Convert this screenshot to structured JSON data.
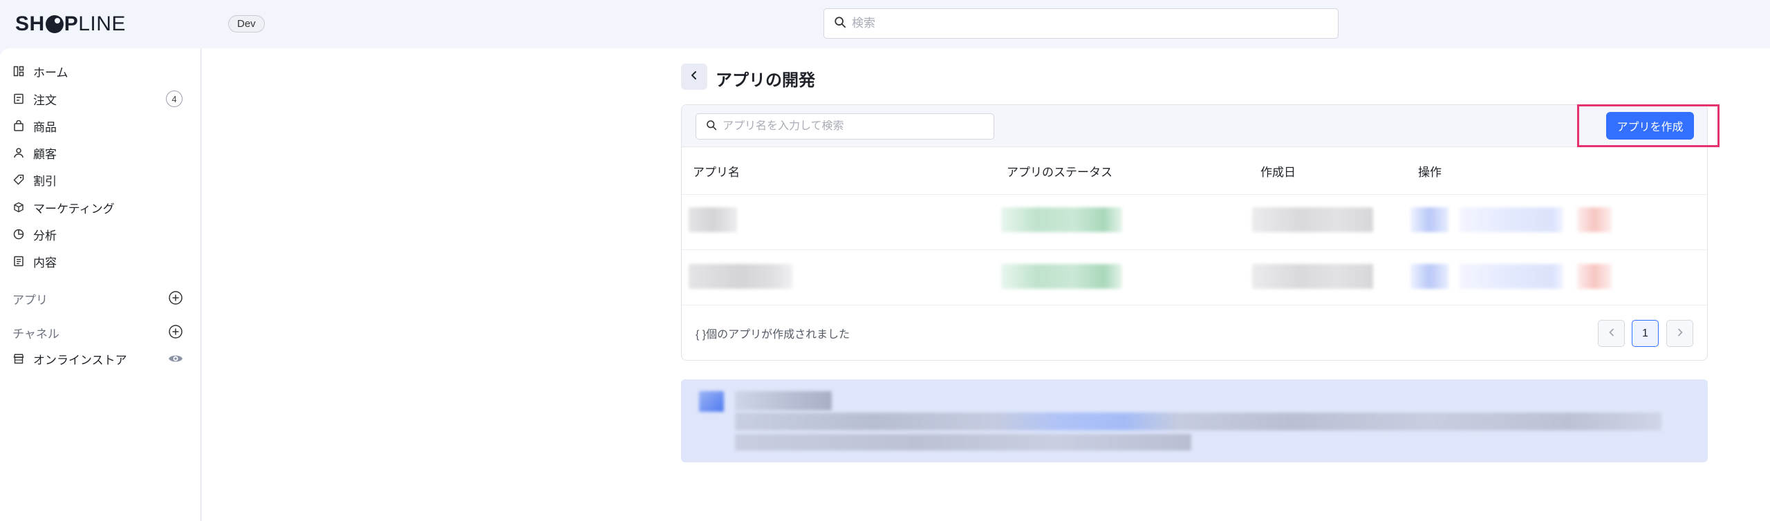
{
  "header": {
    "logo_bold": "SH",
    "logo_bold2": "P",
    "logo_light": "LINE",
    "store_badge": "Dev",
    "search_placeholder": "検索"
  },
  "sidebar": {
    "items": [
      {
        "label": "ホーム",
        "icon": "home-icon"
      },
      {
        "label": "注文",
        "icon": "order-icon",
        "count": "4"
      },
      {
        "label": "商品",
        "icon": "bag-icon"
      },
      {
        "label": "顧客",
        "icon": "person-icon"
      },
      {
        "label": "割引",
        "icon": "tag-icon"
      },
      {
        "label": "マーケティング",
        "icon": "cube-icon"
      },
      {
        "label": "分析",
        "icon": "pie-chart-icon"
      },
      {
        "label": "内容",
        "icon": "document-icon"
      }
    ],
    "apps_label": "アプリ",
    "channels_label": "チャネル",
    "online_store": "オンラインストア"
  },
  "page": {
    "title": "アプリの開発",
    "search_placeholder": "アプリ名を入力して検索",
    "create_button": "アプリを作成",
    "columns": [
      "アプリ名",
      "アプリのステータス",
      "作成日",
      "操作"
    ],
    "footer_text": "{ }個のアプリが作成されました",
    "current_page": "1"
  },
  "colors": {
    "accent": "#3370ff",
    "highlight": "#e6336f",
    "background": "#f3f5fc",
    "banner": "#dfe6fb"
  }
}
